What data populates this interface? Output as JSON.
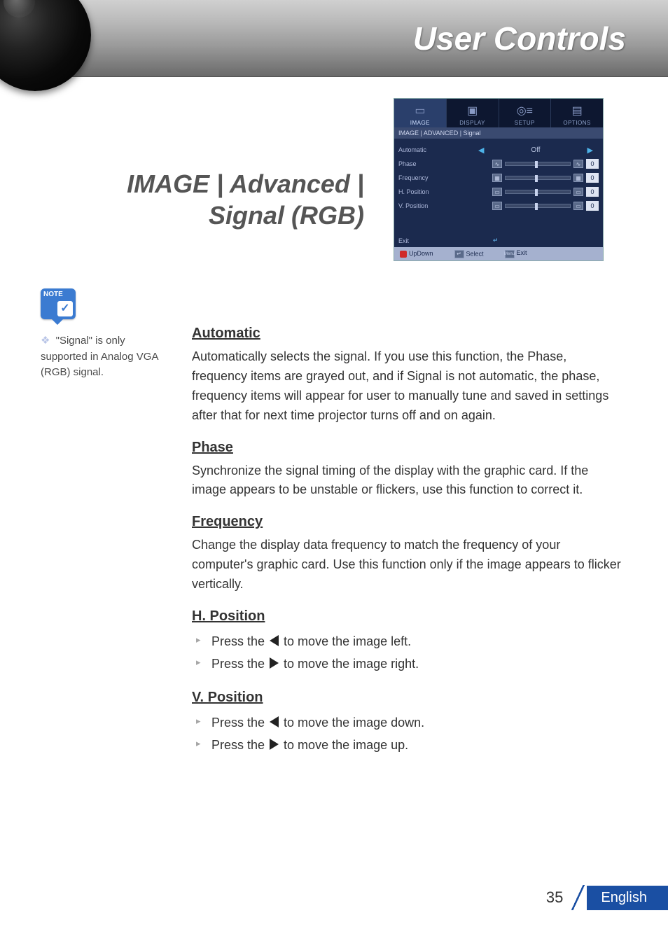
{
  "header": {
    "title": "User Controls"
  },
  "page_title": "IMAGE | Advanced | Signal (RGB)",
  "note": {
    "badge_label": "NOTE",
    "text": "\"Signal\" is only supported in Analog VGA (RGB) signal."
  },
  "osd": {
    "tabs": [
      {
        "label": "IMAGE",
        "active": true
      },
      {
        "label": "DISPLAY",
        "active": false
      },
      {
        "label": "SETUP",
        "active": false
      },
      {
        "label": "OPTIONS",
        "active": false
      }
    ],
    "breadcrumb": "IMAGE | ADVANCED | Signal",
    "rows": [
      {
        "label": "Automatic",
        "type": "toggle",
        "value": "Off"
      },
      {
        "label": "Phase",
        "type": "slider",
        "value": "0"
      },
      {
        "label": "Frequency",
        "type": "slider",
        "value": "0"
      },
      {
        "label": "H. Position",
        "type": "slider",
        "value": "0"
      },
      {
        "label": "V. Position",
        "type": "slider",
        "value": "0"
      }
    ],
    "exit_label": "Exit",
    "footer": {
      "updown": "UpDown",
      "select": "Select",
      "menu_key": "Menu",
      "exit": "Exit"
    }
  },
  "sections": [
    {
      "heading": "Automatic",
      "body": "Automatically selects the signal. If you use this function, the Phase, frequency items are grayed out, and if Signal is not automatic, the phase, frequency items will appear for user to manually tune and saved in settings after that for next time projector turns off and on again."
    },
    {
      "heading": "Phase",
      "body": "Synchronize the signal timing of the display with the graphic card. If the image appears to be unstable or flickers, use this function to correct it."
    },
    {
      "heading": "Frequency",
      "body": "Change the display data frequency to match the frequency of your computer's graphic card. Use this function only if the image appears to flicker vertically."
    },
    {
      "heading": "H. Position",
      "bullets": [
        {
          "pre": "Press the ",
          "icon": "tri-left",
          "post": " to move the image left."
        },
        {
          "pre": "Press the ",
          "icon": "tri-right",
          "post": " to move the image right."
        }
      ]
    },
    {
      "heading": "V. Position",
      "bullets": [
        {
          "pre": "Press the ",
          "icon": "tri-left",
          "post": " to move the image down."
        },
        {
          "pre": "Press the ",
          "icon": "tri-right",
          "post": " to move the image up."
        }
      ]
    }
  ],
  "footer": {
    "page_number": "35",
    "language": "English"
  }
}
